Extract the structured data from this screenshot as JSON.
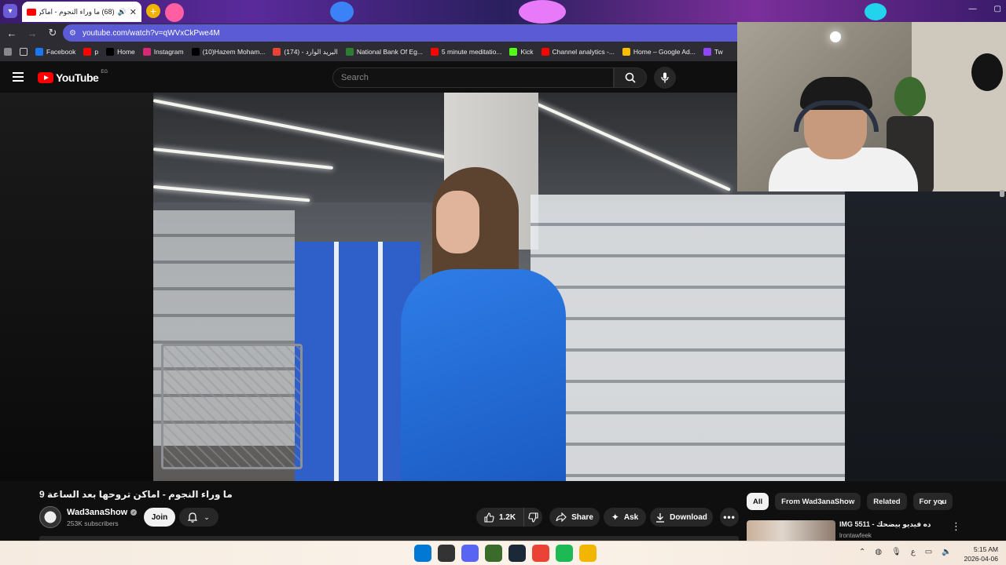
{
  "browser": {
    "tab_title": "(68) ما وراء النجوم - اماكن تر",
    "address": "youtube.com/watch?v=qWVxCkPwe4M",
    "bookmarks": [
      {
        "label": "Facebook",
        "color": "#1877f2",
        "icon": "facebook-icon"
      },
      {
        "label": "p",
        "color": "#ff0000",
        "icon": "youtube-icon"
      },
      {
        "label": "Home",
        "color": "#000000",
        "icon": "x-icon"
      },
      {
        "label": "Instagram",
        "color": "#d62976",
        "icon": "instagram-icon"
      },
      {
        "label": "(10)Hazem Moham...",
        "color": "#000000",
        "icon": "tiktok-icon"
      },
      {
        "label": "(174) - البريد الوارد",
        "color": "#ea4335",
        "icon": "gmail-icon"
      },
      {
        "label": "National Bank Of Eg...",
        "color": "#2e7d32",
        "icon": "bank-icon"
      },
      {
        "label": "5 minute meditatio...",
        "color": "#ff0000",
        "icon": "youtube-icon"
      },
      {
        "label": "Kick",
        "color": "#53fc18",
        "icon": "kick-icon"
      },
      {
        "label": "Channel analytics -...",
        "color": "#ff0000",
        "icon": "youtube-icon"
      },
      {
        "label": "Home – Google Ad...",
        "color": "#fbbc04",
        "icon": "google-ads-icon"
      },
      {
        "label": "Tw",
        "color": "#9146ff",
        "icon": "twitch-icon"
      }
    ]
  },
  "youtube": {
    "logo_text": "YouTube",
    "country_code": "EG",
    "search_placeholder": "Search"
  },
  "video": {
    "title": "ما وراء النجوم - اماكن تروحها بعد الساعة 9",
    "channel": "Wad3anaShow",
    "subscribers": "253K subscribers",
    "join_label": "Join",
    "likes": "1.2K",
    "share_label": "Share",
    "ask_label": "Ask",
    "download_label": "Download"
  },
  "sidebar": {
    "chips": [
      "All",
      "From Wad3anaShow",
      "Related",
      "For you"
    ],
    "recommendation": {
      "title": "IMG 5511 - ده فيديو بيضحك",
      "channel": "lrontawfeek"
    }
  },
  "taskbar": {
    "apps": [
      {
        "icon": "windows-start-icon",
        "color": "#0078d4"
      },
      {
        "icon": "app-red-dot-icon",
        "color": "#333333"
      },
      {
        "icon": "discord-icon",
        "color": "#5865f2"
      },
      {
        "icon": "cs-icon",
        "color": "#3a6b2a"
      },
      {
        "icon": "steam-icon",
        "color": "#1b2838"
      },
      {
        "icon": "chrome-icon",
        "color": "#ea4335"
      },
      {
        "icon": "spotify-icon",
        "color": "#1db954"
      },
      {
        "icon": "file-explorer-icon",
        "color": "#f2b600"
      }
    ],
    "ime": "ع",
    "time": "5:15 AM",
    "date": "2026-04-06"
  }
}
